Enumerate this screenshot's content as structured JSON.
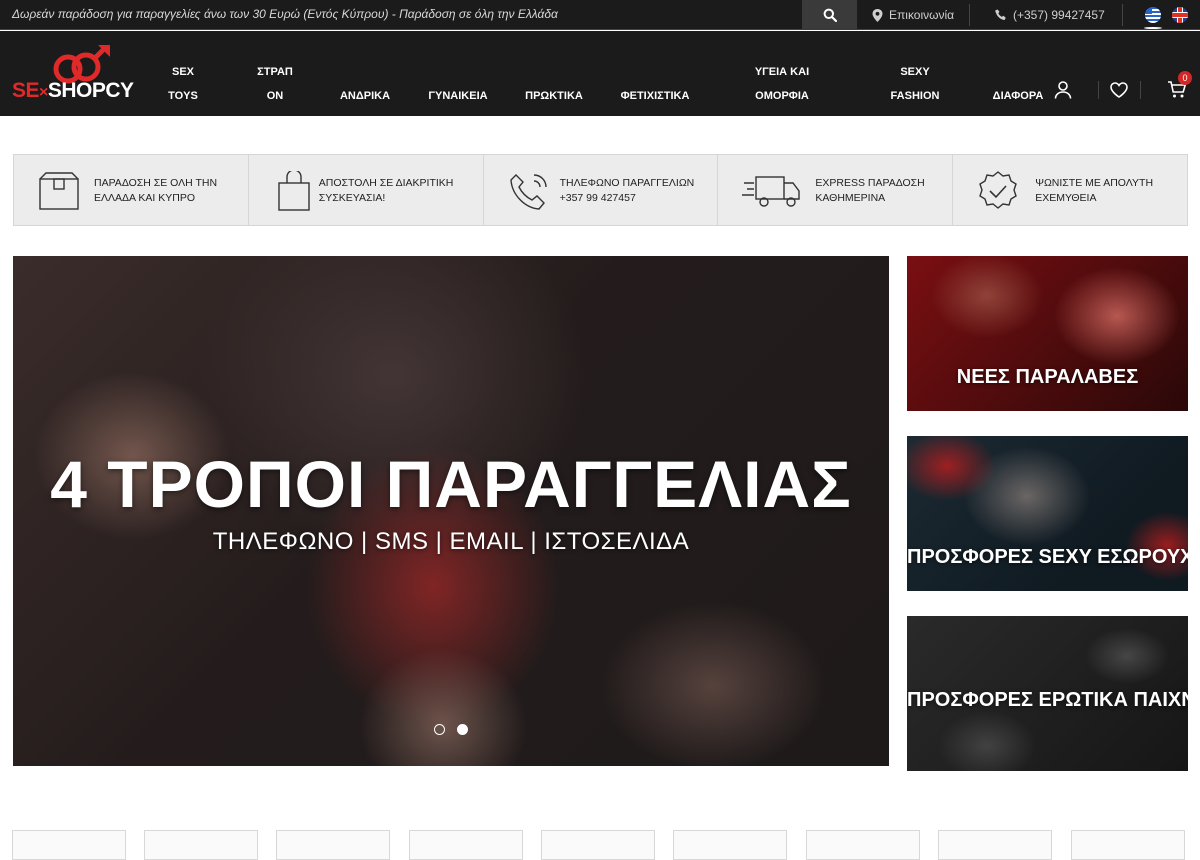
{
  "topbar": {
    "promo": "Δωρεάν παράδοση για παραγγελίες άνω των 30 Ευρώ (Εντός Κύπρου) - Παράδοση σε όλη την Ελλάδα",
    "contact_label": "Επικοινωνία",
    "phone": "(+357) 99427457",
    "languages": [
      "greek-flag",
      "english-flag"
    ]
  },
  "header": {
    "logo": {
      "part1": "SE",
      "part2": "×",
      "part3": "SHOPCY"
    },
    "nav": [
      {
        "line1": "SEX",
        "line2": "TOYS"
      },
      {
        "line1": "ΣΤΡΑΠ",
        "line2": "ON"
      },
      {
        "line1": "",
        "line2": "ΑΝΔΡΙΚΑ"
      },
      {
        "line1": "",
        "line2": "ΓΥΝΑΙΚΕΙΑ"
      },
      {
        "line1": "",
        "line2": "ΠΡΩΚΤΙΚΑ"
      },
      {
        "line1": "",
        "line2": "ΦΕΤΙΧΙΣΤΙΚΑ"
      },
      {
        "line1": "ΥΓΕΙΑ ΚΑΙ",
        "line2": "ΟΜΟΡΦΙΑ"
      },
      {
        "line1": "SEXY",
        "line2": "FASHION"
      },
      {
        "line1": "",
        "line2": "ΔΙΑΦΟΡΑ"
      }
    ],
    "cart_count": "0"
  },
  "features": [
    {
      "icon": "box-icon",
      "line1": "ΠΑΡΑΔΟΣΗ ΣΕ ΟΛΗ ΤΗΝ",
      "line2": "ΕΛΛΑΔΑ ΚΑΙ ΚΥΠΡΟ"
    },
    {
      "icon": "shopping-bag-icon",
      "line1": "ΑΠΟΣΤΟΛΗ ΣΕ ΔΙΑΚΡΙΤΙΚΗ",
      "line2": "ΣΥΣΚΕΥΑΣΙΑ!"
    },
    {
      "icon": "phone-icon",
      "line1": "ΤΗΛΕΦΩΝΟ ΠΑΡΑΓΓΕΛΙΩΝ",
      "line2": "+357 99 427457"
    },
    {
      "icon": "truck-icon",
      "line1": "EXPRESS ΠΑΡΑΔΟΣΗ",
      "line2": "ΚΑΘΗΜΕΡΙΝΑ"
    },
    {
      "icon": "badge-check-icon",
      "line1": "ΨΩΝΙΣΤΕ ΜΕ ΑΠΟΛΥΤΗ",
      "line2": "ΕΧΕΜΥΘΕΙΑ"
    }
  ],
  "hero": {
    "title": "4 ΤΡΟΠΟΙ ΠΑΡΑΓΓΕΛΙΑΣ",
    "subtitle": "ΤΗΛΕΦΩΝΟ  |  SMS  |  EMAIL  |  ΙΣΤΟΣΕΛΙΔΑ",
    "slide_count": 2,
    "active_slide": 2
  },
  "banners": [
    {
      "label": "ΝΕΕΣ ΠΑΡΑΛΑΒΕΣ"
    },
    {
      "label": "ΠΡΟΣΦΟΡΕΣ SEXY ΕΣΩΡΟΥΧΑ"
    },
    {
      "label": "ΠΡΟΣΦΟΡΕΣ ΕΡΩΤΙΚΑ ΠΑΙΧΝΙΔΙΑ"
    }
  ],
  "colors": {
    "header_bg": "#1b1b1b",
    "accent": "#e02a2a",
    "feature_bg": "#ececec"
  }
}
